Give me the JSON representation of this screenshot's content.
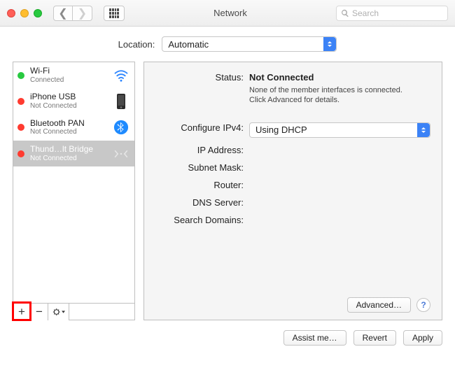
{
  "window": {
    "title": "Network"
  },
  "search": {
    "placeholder": "Search"
  },
  "location": {
    "label": "Location:",
    "value": "Automatic"
  },
  "sidebar": {
    "items": [
      {
        "name": "Wi-Fi",
        "sub": "Connected",
        "status_color": "#28c940",
        "icon": "wifi"
      },
      {
        "name": "iPhone USB",
        "sub": "Not Connected",
        "status_color": "#ff3b30",
        "icon": "phone"
      },
      {
        "name": "Bluetooth PAN",
        "sub": "Not Connected",
        "status_color": "#ff3b30",
        "icon": "bluetooth"
      },
      {
        "name": "Thund…lt Bridge",
        "sub": "Not Connected",
        "status_color": "#ff3b30",
        "icon": "thunderbolt",
        "selected": true
      }
    ],
    "add": "+",
    "remove": "−",
    "gear": "✱⌄"
  },
  "detail": {
    "labels": {
      "status": "Status:",
      "configure": "Configure IPv4:",
      "ip": "IP Address:",
      "subnet": "Subnet Mask:",
      "router": "Router:",
      "dns": "DNS Server:",
      "domains": "Search Domains:"
    },
    "status_value": "Not Connected",
    "status_hint1": "None of the member interfaces is connected.",
    "status_hint2": "Click Advanced for details.",
    "configure_value": "Using DHCP",
    "ip": "",
    "subnet": "",
    "router": "",
    "dns": "",
    "domains": "",
    "advanced": "Advanced…",
    "help": "?"
  },
  "footer": {
    "assist": "Assist me…",
    "revert": "Revert",
    "apply": "Apply"
  }
}
